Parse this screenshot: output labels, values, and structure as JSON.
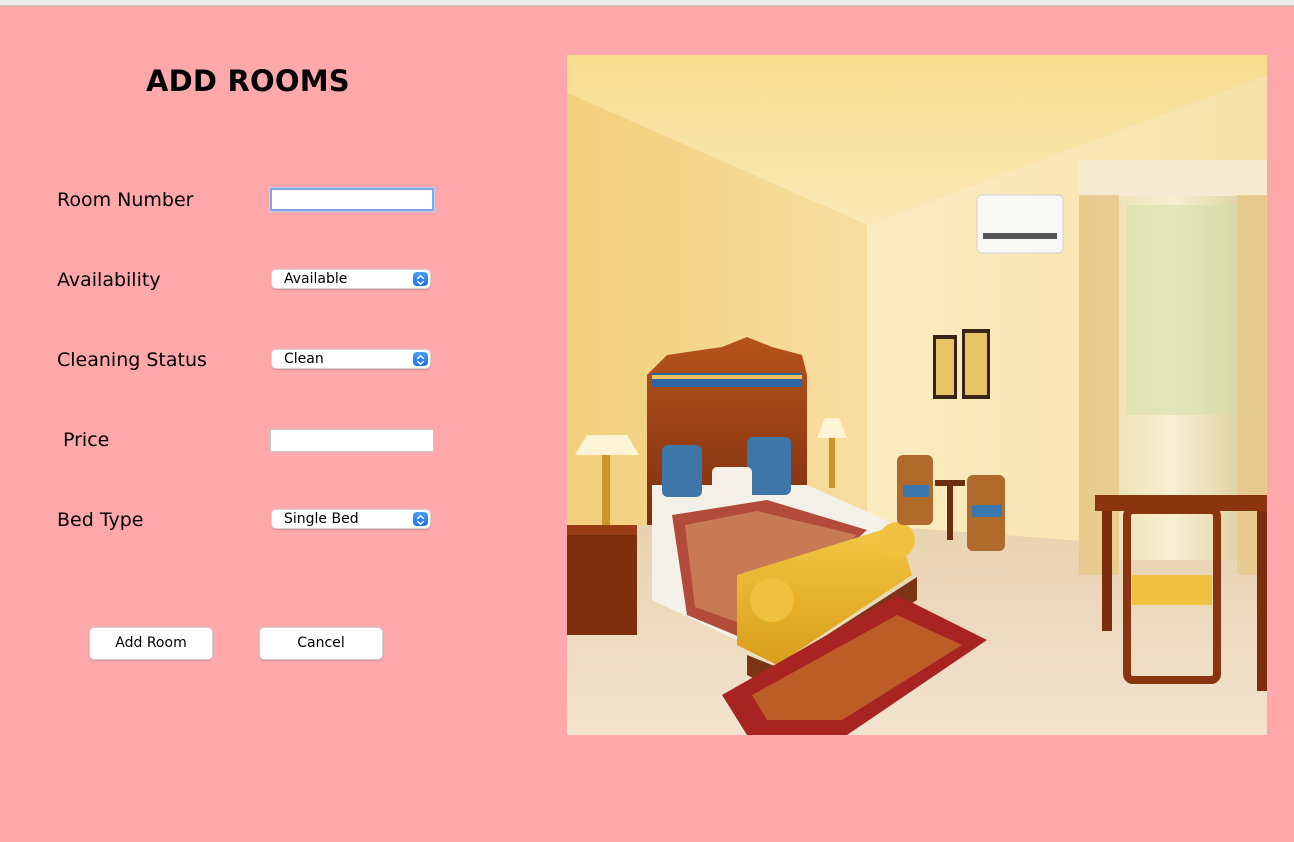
{
  "colors": {
    "background": "#ffa8ab",
    "accent": "#1a6ff0"
  },
  "form": {
    "title": "ADD ROOMS",
    "room_number": {
      "label": "Room Number",
      "value": ""
    },
    "availability": {
      "label": "Availability",
      "selected": "Available"
    },
    "cleaning_status": {
      "label": "Cleaning Status",
      "selected": "Clean"
    },
    "price": {
      "label": "Price",
      "value": ""
    },
    "bed_type": {
      "label": "Bed Type",
      "selected": "Single Bed"
    },
    "add_room_label": "Add Room",
    "cancel_label": "Cancel"
  },
  "icons": {
    "combo_arrow": "chevron-up-down-icon"
  }
}
